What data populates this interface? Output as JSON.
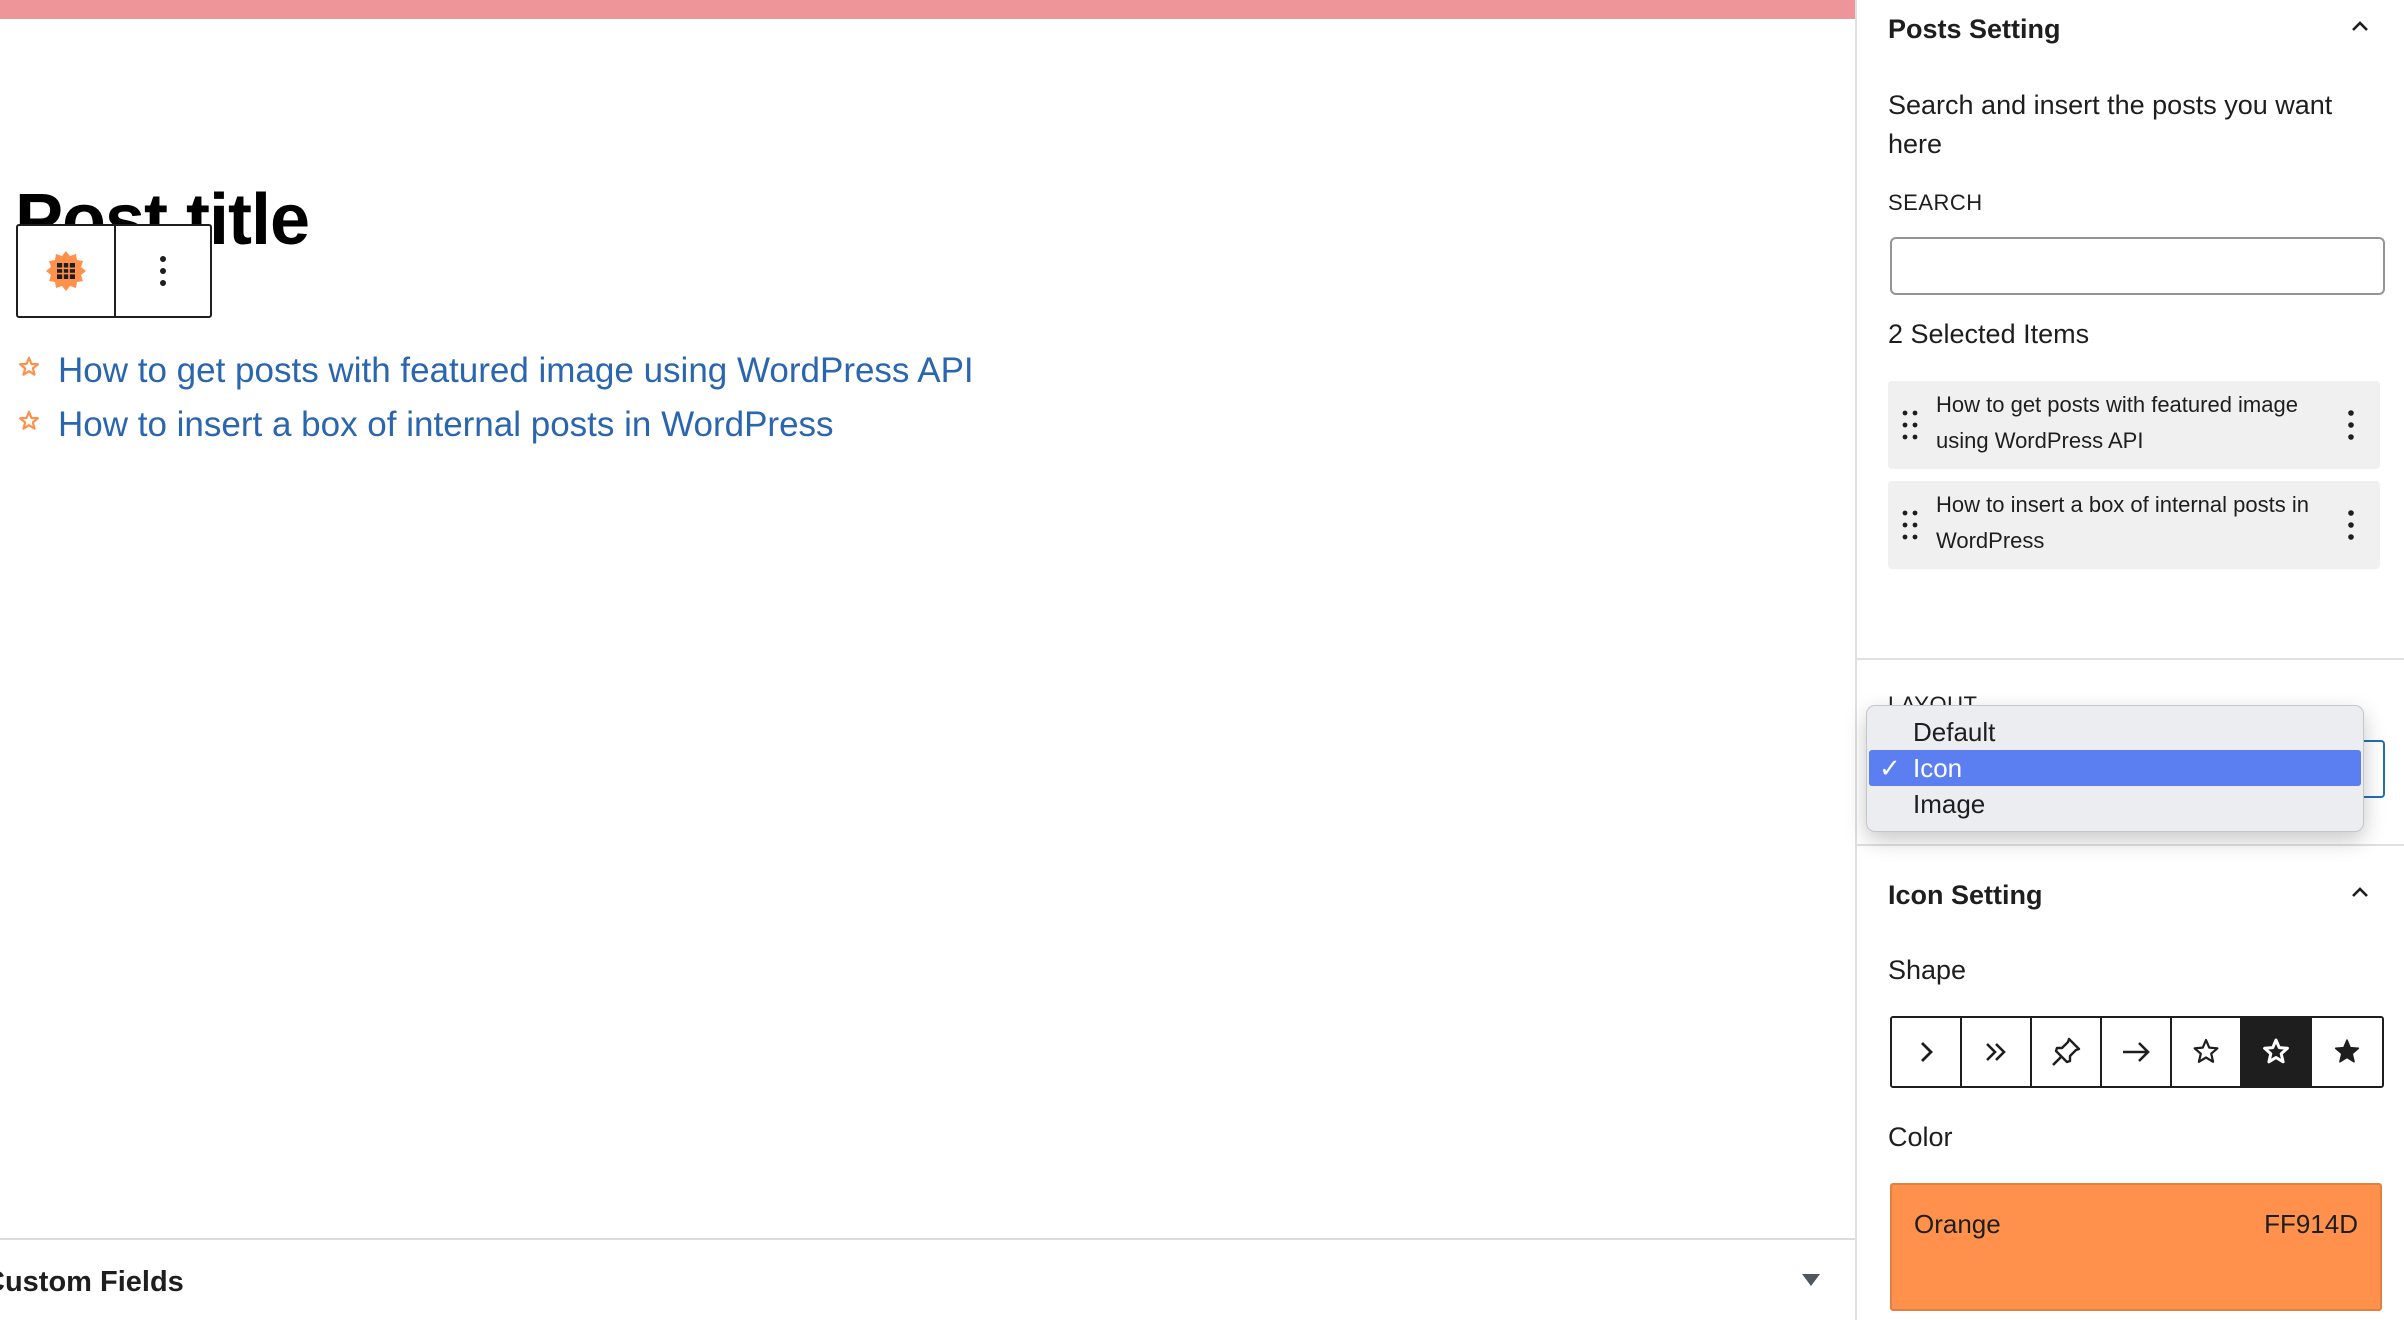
{
  "editor": {
    "post_title": "Post title",
    "posts": [
      {
        "title": "How to get posts with featured image using WordPress API"
      },
      {
        "title": "How to insert a box of internal posts in WordPress"
      }
    ],
    "custom_fields_label": "Custom Fields",
    "block_icon": "table-grid-icon",
    "more_icon": "vertical-ellipsis-icon"
  },
  "sidebar": {
    "posts_setting": {
      "title": "Posts Setting",
      "description": "Search and insert the posts you want here",
      "search_label": "SEARCH",
      "search_value": "",
      "selected_count_label": "2 Selected Items",
      "selected_items": [
        {
          "title": "How to get posts with featured image using WordPress API"
        },
        {
          "title": "How to insert a box of internal posts in WordPress"
        }
      ]
    },
    "layout": {
      "label": "LAYOUT",
      "options": [
        "Default",
        "Icon",
        "Image"
      ],
      "selected": "Icon",
      "check_mark": "✓"
    },
    "icon_setting": {
      "title": "Icon Setting",
      "shape_label": "Shape",
      "shapes": [
        {
          "icon": "chevron-right-icon",
          "active": false
        },
        {
          "icon": "double-chevron-right-icon",
          "active": false
        },
        {
          "icon": "pin-icon",
          "active": false
        },
        {
          "icon": "arrow-right-icon",
          "active": false
        },
        {
          "icon": "star-outline-icon",
          "active": false
        },
        {
          "icon": "star-outline-bold-icon",
          "active": true
        },
        {
          "icon": "star-filled-icon",
          "active": false
        }
      ],
      "color_label": "Color",
      "color_name": "Orange",
      "color_hex": "FF914D",
      "color_value": "#FF914D"
    }
  },
  "colors": {
    "accent": "#FF914D",
    "link": "#2A65B0",
    "top_strip": "#EE959A",
    "dropdown_highlight": "#5B7FF0"
  }
}
